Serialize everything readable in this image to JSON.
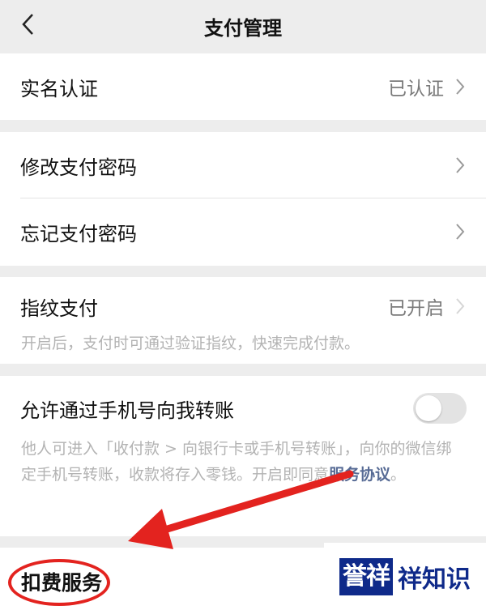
{
  "navbar": {
    "title": "支付管理",
    "back_icon": "chevron-left-icon"
  },
  "sections": {
    "real_name": {
      "label": "实名认证",
      "value": "已认证"
    },
    "password": {
      "change_label": "修改支付密码",
      "forgot_label": "忘记支付密码"
    },
    "fingerprint": {
      "label": "指纹支付",
      "value": "已开启",
      "description": "开启后，支付时可通过验证指纹，快速完成付款。"
    },
    "phone_transfer": {
      "label": "允许通过手机号向我转账",
      "toggle_on": false,
      "description": "他人可进入「收付款 > 向银行卡或手机号转账」，向你的微信绑定手机号转账，收款将存入零钱。开启即同意",
      "link": "服务协议",
      "description_tail": "。"
    },
    "deduction": {
      "label": "扣费服务"
    }
  },
  "watermark": {
    "badge": "誉祥",
    "text": "祥知识"
  },
  "colors": {
    "annotation_red": "#e3231f",
    "link_blue": "#576b95",
    "watermark_blue": "#0f2a8a"
  }
}
